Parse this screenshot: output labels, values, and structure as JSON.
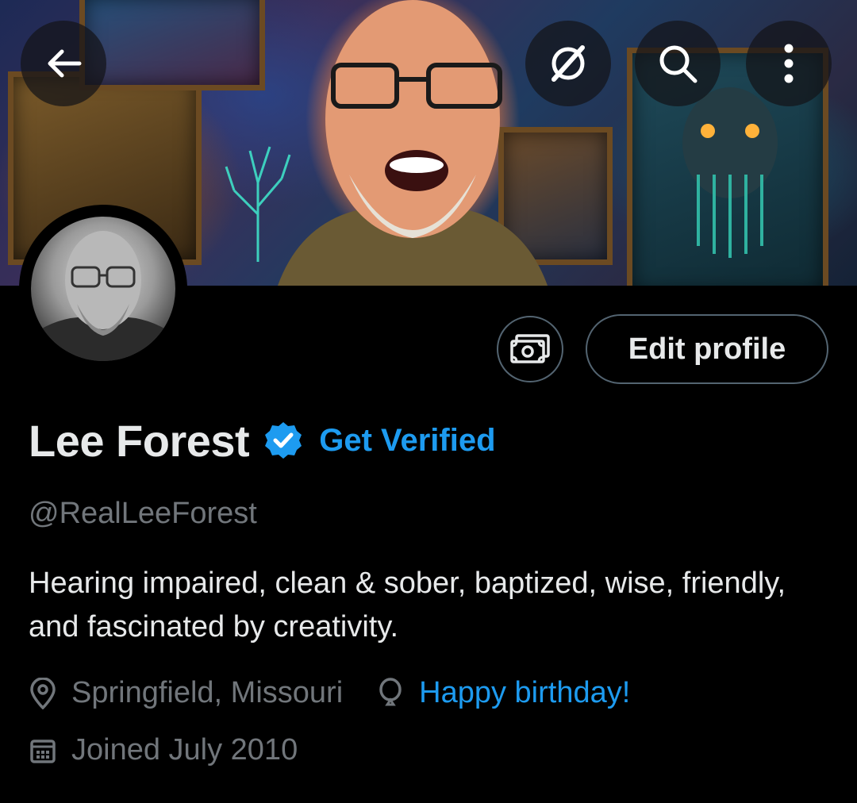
{
  "header": {
    "back_icon": "arrow-left-icon",
    "grok_icon": "grok-icon",
    "search_icon": "search-icon",
    "more_icon": "more-vertical-icon"
  },
  "profile": {
    "display_name": "Lee Forest",
    "verified_icon": "verified-badge-icon",
    "get_verified_label": "Get Verified",
    "handle": "@RealLeeForest",
    "bio": "Hearing impaired, clean & sober, baptized, wise, friendly, and fascinated by creativity.",
    "location": "Springfield, Missouri",
    "birthday": "Happy birthday!",
    "joined": "Joined July 2010"
  },
  "actions": {
    "subscriptions_icon": "money-icon",
    "edit_profile_label": "Edit profile"
  },
  "colors": {
    "background": "#000000",
    "accent": "#1d9bf0",
    "secondary_text": "#71767b",
    "border": "#536471"
  }
}
